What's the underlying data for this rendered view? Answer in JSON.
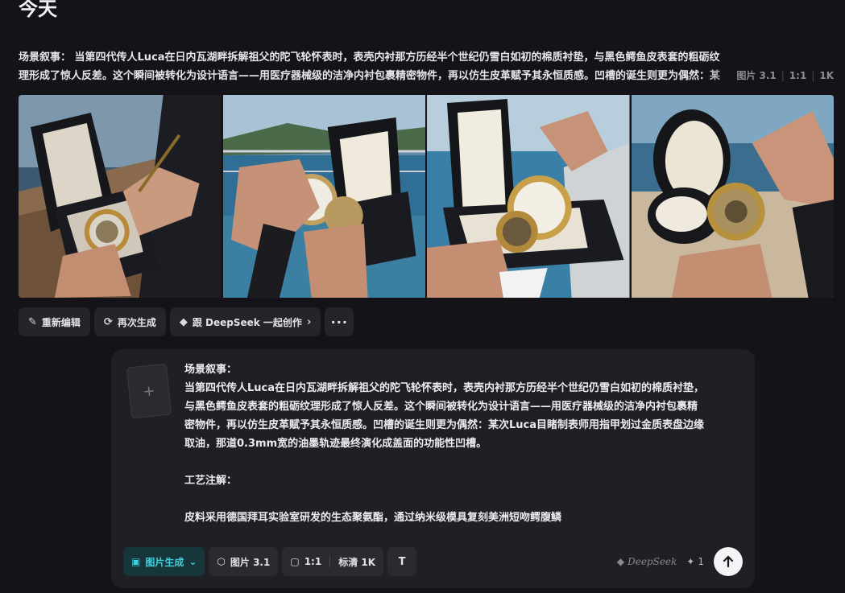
{
  "page": {
    "title": "今天"
  },
  "description": {
    "text": "场景叙事： 当第四代传人Luca在日内瓦湖畔拆解祖父的陀飞轮怀表时，表壳内衬那方历经半个世纪仍雪白如初的棉质衬垫，与黑色鳄鱼皮表套的粗砺纹理形成了惊人反差。这个瞬间被转化为设计语言——用医疗器械级的洁净内衬包裹精密物件，再以仿生皮革赋予其永恒质感。凹槽的诞生则更为偶然：某次",
    "model": "图片 3.1",
    "ratio": "1:1",
    "resolution": "1K"
  },
  "gallery": {
    "images": [
      {
        "name": "image-1"
      },
      {
        "name": "image-2"
      },
      {
        "name": "image-3"
      },
      {
        "name": "image-4"
      }
    ]
  },
  "actions": {
    "reedit": "重新编辑",
    "regenerate": "再次生成",
    "create_with": "跟 DeepSeek 一起创作",
    "more": "···"
  },
  "composer": {
    "lines": [
      "场景叙事：",
      "当第四代传人Luca在日内瓦湖畔拆解祖父的陀飞轮怀表时，表壳内衬那方历经半个世纪仍雪白如初的棉质衬垫，",
      "与黑色鳄鱼皮表套的粗砺纹理形成了惊人反差。这个瞬间被转化为设计语言——用医疗器械级的洁净内衬包裹精",
      "密物件，再以仿生皮革赋予其永恒质感。凹槽的诞生则更为偶然：某次Luca目睹制表师用指甲划过金质表盘边缘",
      "取油，那道0.3mm宽的油墨轨迹最终演化成盖面的功能性凹槽。",
      "",
      "工艺注解：",
      "",
      "皮料采用德国拜耳实验室研发的生态聚氨酯，通过纳米级模具复刻美洲短吻鳄腹鳞"
    ],
    "attach_glyph": "+",
    "mode": "图片生成",
    "model": "图片 3.1",
    "ratio": "1:1",
    "quality": "标清 1K",
    "text_tool": "T",
    "brand": "DeepSeek",
    "credits": "1"
  },
  "colors": {
    "background": "#141418",
    "accent": "#3fd0e0"
  }
}
